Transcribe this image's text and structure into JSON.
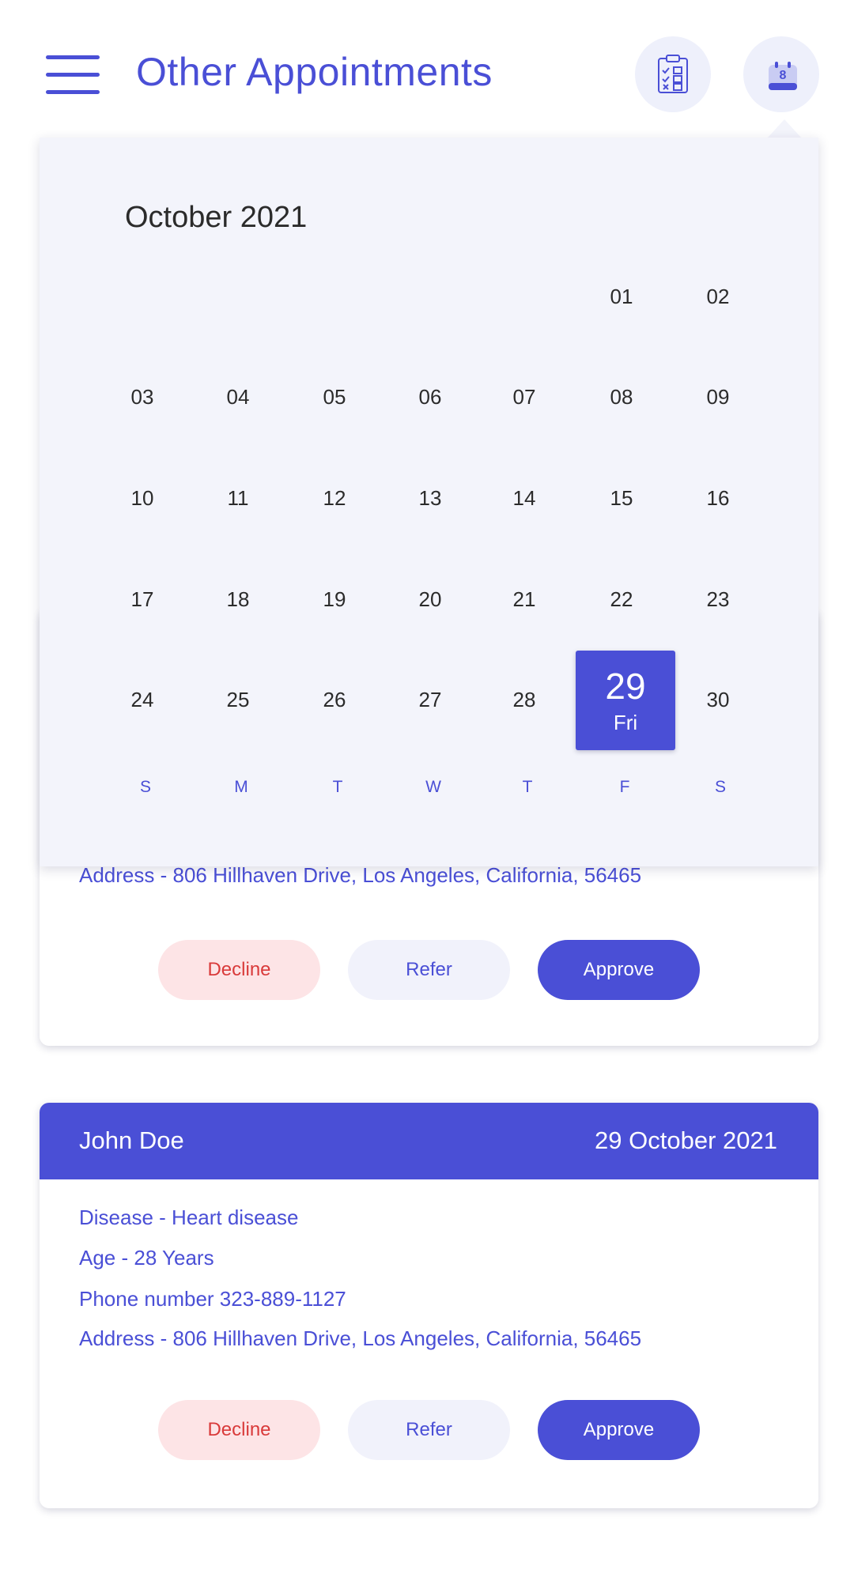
{
  "header": {
    "title": "Other Appointments",
    "calendar_badge": "8"
  },
  "calendar": {
    "month_label": "October 2021",
    "weekday_labels": [
      "S",
      "M",
      "T",
      "W",
      "T",
      "F",
      "S"
    ],
    "selected": {
      "day": "29",
      "weekday": "Fri"
    },
    "weeks": [
      [
        "",
        "",
        "",
        "",
        "",
        "01",
        "02"
      ],
      [
        "03",
        "04",
        "05",
        "06",
        "07",
        "08",
        "09"
      ],
      [
        "10",
        "11",
        "12",
        "13",
        "14",
        "15",
        "16"
      ],
      [
        "17",
        "18",
        "19",
        "20",
        "21",
        "22",
        "23"
      ],
      [
        "24",
        "25",
        "26",
        "27",
        "28",
        "29",
        "30"
      ]
    ]
  },
  "appointments": [
    {
      "address": "Address - 806 Hillhaven Drive, Los Angeles, California, 56465",
      "buttons": {
        "decline": "Decline",
        "refer": "Refer",
        "approve": "Approve"
      }
    },
    {
      "name": "John Doe",
      "date": "29 October 2021",
      "disease": "Disease - Heart disease",
      "age": "Age - 28 Years",
      "phone": "Phone number  323-889-1127",
      "address": "Address - 806 Hillhaven Drive, Los Angeles, California, 56465",
      "buttons": {
        "decline": "Decline",
        "refer": "Refer",
        "approve": "Approve"
      }
    }
  ],
  "colors": {
    "accent": "#4a4fd6",
    "decline_bg": "#fde4e6",
    "decline_text": "#d93a3a",
    "refer_bg": "#f1f2fb",
    "popup_bg": "#f3f4fb"
  }
}
